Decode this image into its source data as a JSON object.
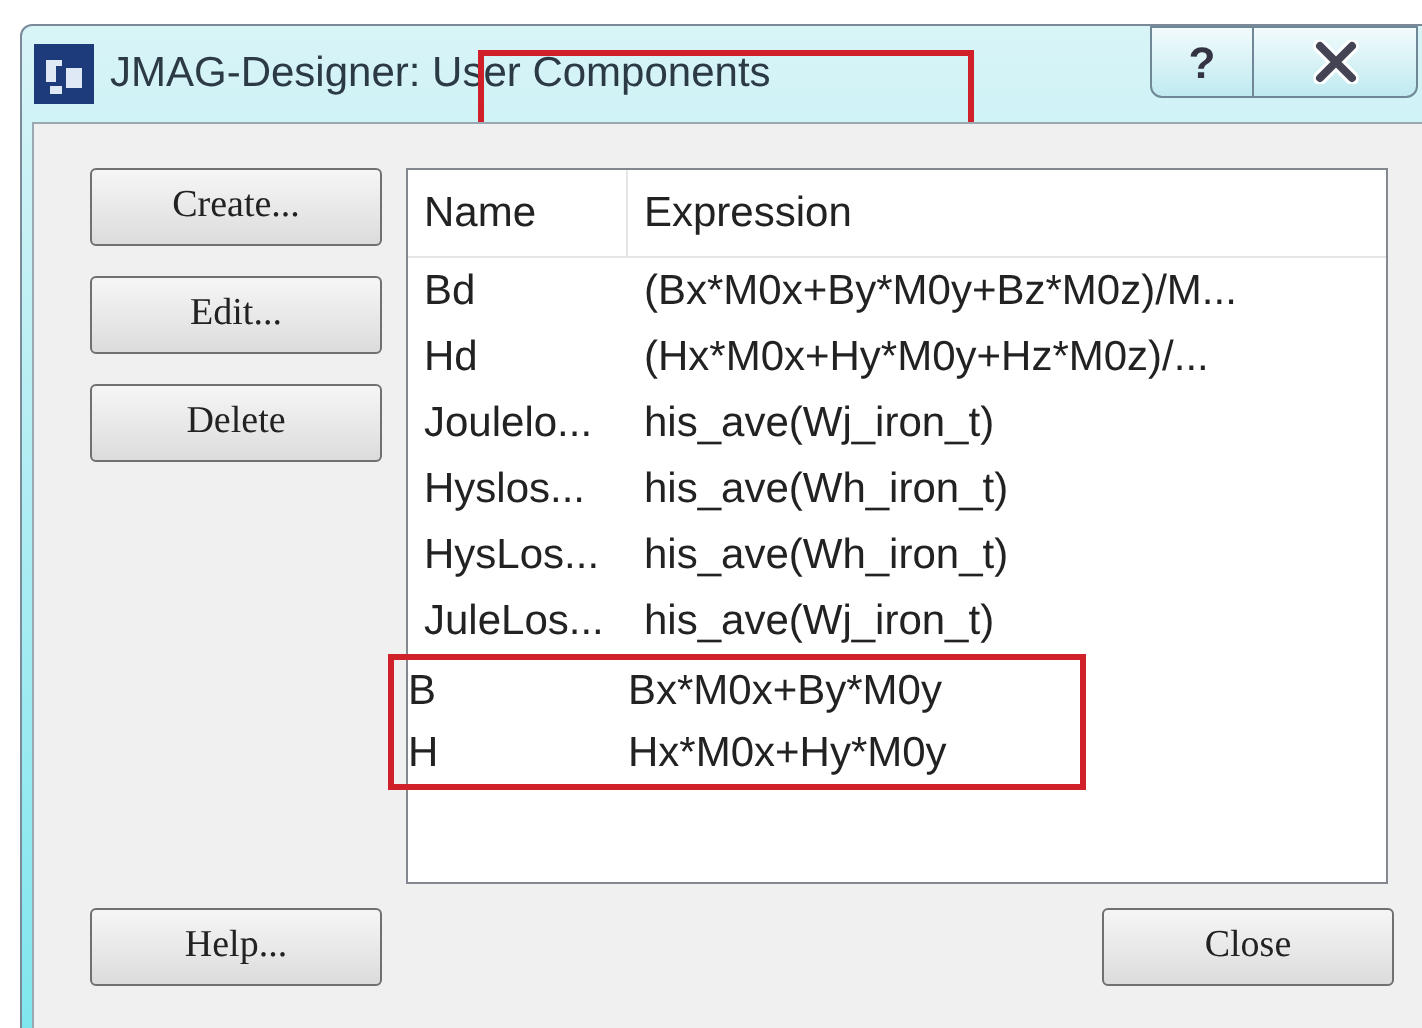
{
  "window": {
    "title": "JMAG-Designer: User Components",
    "title_highlight": true,
    "help_glyph": "?"
  },
  "side_buttons": [
    "Create...",
    "Edit...",
    "Delete"
  ],
  "table": {
    "columns": [
      "Name",
      "Expression"
    ],
    "rows": [
      {
        "name": "Bd",
        "expression": "(Bx*M0x+By*M0y+Bz*M0z)/M...",
        "highlighted": false
      },
      {
        "name": "Hd",
        "expression": "(Hx*M0x+Hy*M0y+Hz*M0z)/...",
        "highlighted": false
      },
      {
        "name": "Joulelo...",
        "expression": "his_ave(Wj_iron_t)",
        "highlighted": false
      },
      {
        "name": "Hyslos...",
        "expression": "his_ave(Wh_iron_t)",
        "highlighted": false
      },
      {
        "name": "HysLos...",
        "expression": "his_ave(Wh_iron_t)",
        "highlighted": false
      },
      {
        "name": "JuleLos...",
        "expression": "his_ave(Wj_iron_t)",
        "highlighted": false
      },
      {
        "name": "B",
        "expression": "Bx*M0x+By*M0y",
        "highlighted": true
      },
      {
        "name": "H",
        "expression": "Hx*M0x+Hy*M0y",
        "highlighted": true
      }
    ]
  },
  "footer_buttons": [
    "Help...",
    "Close"
  ]
}
